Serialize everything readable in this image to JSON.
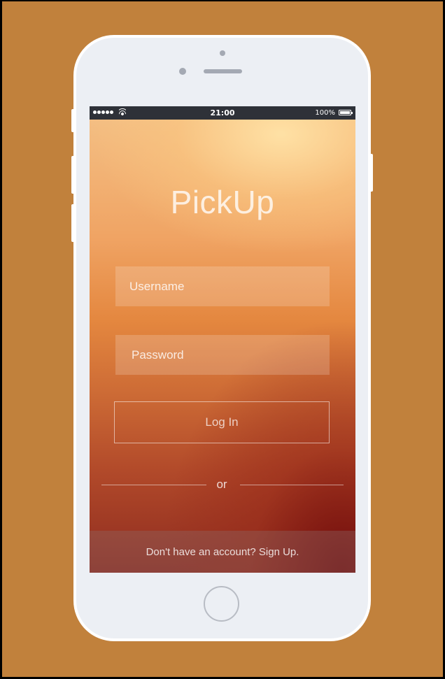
{
  "app": {
    "name": "PickUp"
  },
  "status_bar": {
    "time": "21:00",
    "battery": "100%"
  },
  "login_form": {
    "username_placeholder": "Username",
    "password_placeholder": "Password",
    "login_label": "Log In",
    "divider_text": "or"
  },
  "footer": {
    "signup_prompt": "Don't have an account? Sign Up."
  },
  "colors": {
    "background": "#c1813c",
    "phone_body": "#eceff4",
    "status_bar": "#2e3138"
  }
}
